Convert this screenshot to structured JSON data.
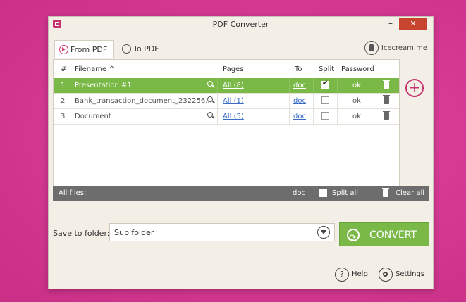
{
  "window": {
    "title": "PDF Converter",
    "minimize": "–",
    "close": "✕"
  },
  "tabs": [
    {
      "label": "From PDF",
      "active": true
    },
    {
      "label": "To PDF",
      "active": false
    }
  ],
  "brand": "Icecream.me",
  "table": {
    "headers": {
      "num": "#",
      "filename": "Filename ^",
      "pages": "Pages",
      "to": "To",
      "split": "Split",
      "password": "Password"
    },
    "rows": [
      {
        "num": "1",
        "filename": "Presentation #1",
        "pages": "All (8)",
        "to": "doc",
        "split": true,
        "password": "ok",
        "selected": true
      },
      {
        "num": "2",
        "filename": "Bank_transaction_document_232256...",
        "pages": "All (1)",
        "to": "doc",
        "split": false,
        "password": "ok",
        "selected": false
      },
      {
        "num": "3",
        "filename": "Document",
        "pages": "All (5)",
        "to": "doc",
        "split": false,
        "password": "ok",
        "selected": false
      }
    ]
  },
  "all_files": {
    "label": "All files:",
    "to": "doc",
    "split_all": "Split all",
    "clear_all": "Clear all"
  },
  "save": {
    "label": "Save to folder:",
    "value": "Sub folder"
  },
  "convert": {
    "label": "CONVERT"
  },
  "footer": {
    "help": "Help",
    "settings": "Settings"
  },
  "colors": {
    "accent_green": "#7ab848",
    "brand_pink": "#c8336f",
    "background_pink": "#d63a93"
  }
}
